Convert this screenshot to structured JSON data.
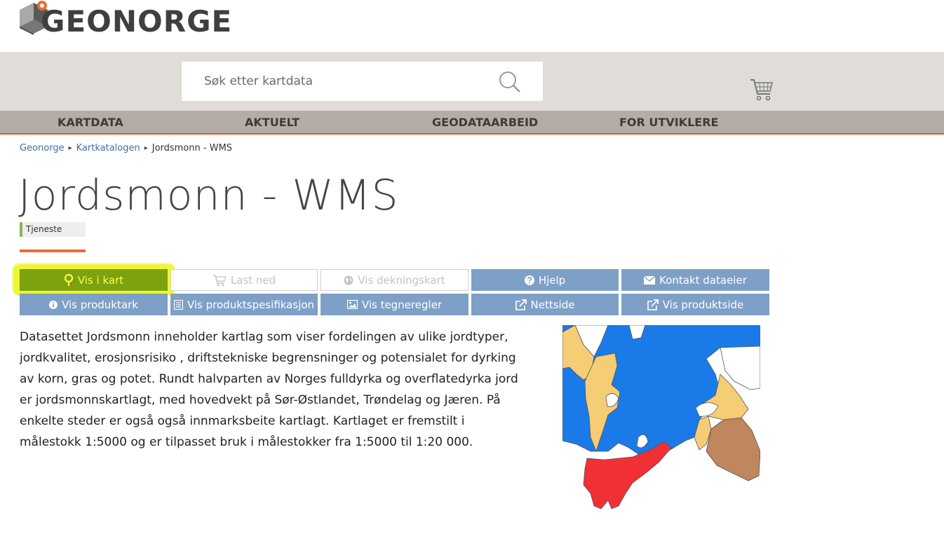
{
  "header": {
    "logo_text": "GEONORGE",
    "search": {
      "placeholder": "Søk etter kartdata",
      "value": ""
    }
  },
  "nav": {
    "items": [
      {
        "label": "KARTDATA"
      },
      {
        "label": "AKTUELT"
      },
      {
        "label": "GEODATAARBEID"
      },
      {
        "label": "FOR UTVIKLERE"
      }
    ]
  },
  "breadcrumb": {
    "items": [
      {
        "label": "Geonorge"
      },
      {
        "label": "Kartkatalogen"
      },
      {
        "label": "Jordsmonn - WMS"
      }
    ],
    "separator": "▸"
  },
  "page": {
    "title": "Jordsmonn - WMS",
    "type_badge": "Tjeneste"
  },
  "actions": {
    "row1": [
      {
        "label": "Vis i kart",
        "icon": "map-marker-icon",
        "state": "active"
      },
      {
        "label": "Last ned",
        "icon": "cart-icon",
        "state": "disabled"
      },
      {
        "label": "Vis dekningskart",
        "icon": "globe-icon",
        "state": "disabled"
      },
      {
        "label": "Hjelp",
        "icon": "question-circle-icon",
        "state": "enabled"
      },
      {
        "label": "Kontakt dataeier",
        "icon": "envelope-icon",
        "state": "enabled"
      }
    ],
    "row2": [
      {
        "label": "Vis produktark",
        "icon": "info-circle-icon",
        "state": "enabled"
      },
      {
        "label": "Vis produktspesifikasjon",
        "icon": "document-icon",
        "state": "enabled"
      },
      {
        "label": "Vis tegneregler",
        "icon": "picture-icon",
        "state": "enabled"
      },
      {
        "label": "Nettside",
        "icon": "external-link-icon",
        "state": "enabled"
      },
      {
        "label": "Vis produktside",
        "icon": "external-link-icon",
        "state": "enabled"
      }
    ]
  },
  "description": "Datasettet Jordsmonn inneholder kartlag som viser fordelingen av ulike jordtyper, jordkvalitet, erosjonsrisiko , driftstekniske begrensninger og potensialet for dyrking av korn, gras og potet. Rundt halvparten av Norges fulldyrka og overflatedyrka jord er jordsmonnskartlagt, med hovedvekt på Sør-Østlandet, Trøndelag og Jæren. På enkelte steder er også også innmarksbeite kartlagt. Kartlaget er fremstilt i målestokk 1:5000 og er tilpasset bruk i målestokker fra 1:5000 til 1:20 000.",
  "colors": {
    "accent": "#e0532a",
    "button_blue": "#7ea0c7",
    "button_active": "#7da210",
    "highlight": "#eef52c",
    "map_blue": "#1a7ae8",
    "map_tan": "#f5cd75",
    "map_red": "#f03035",
    "map_brown": "#c0865e"
  }
}
